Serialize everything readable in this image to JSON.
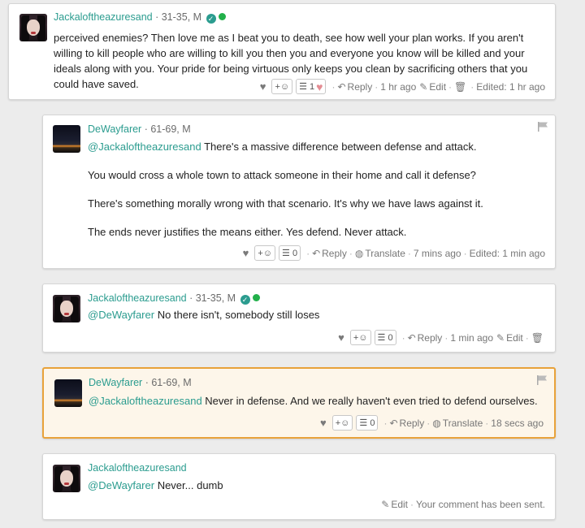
{
  "comments": [
    {
      "username": "Jackaloftheazuresand",
      "demo": "31-35, M",
      "verified": true,
      "online": true,
      "body": "perceived enemies? Then love me as I beat you to death, see how well your plan works. If you aren't willing to kill people who are willing to kill you then you and everyone you know will be killed and your ideals along with you. Your pride for being virtuous only keeps you clean by sacrificing others that you could have saved.",
      "smile": "+☺",
      "count": "1",
      "reply": "Reply",
      "time": "1 hr ago",
      "edit": "Edit",
      "edited": "Edited: 1 hr ago"
    },
    {
      "username": "DeWayfarer",
      "demo": "61-69, M",
      "mention": "@Jackaloftheazuresand",
      "body_first": "There's a massive difference between defense and attack.",
      "paragraphs": [
        "You would cross a whole town to attack someone in their home and call it defense?",
        "There's something morally wrong with that scenario. It's why we have laws against it.",
        "The ends never justifies the means either. Yes defend. Never attack."
      ],
      "smile": "+☺",
      "count": "0",
      "reply": "Reply",
      "translate": "Translate",
      "time": "7 mins ago",
      "edited": "Edited: 1 min ago"
    },
    {
      "username": "Jackaloftheazuresand",
      "demo": "31-35, M",
      "mention": "@DeWayfarer",
      "body": "No there isn't, somebody still loses",
      "smile": "+☺",
      "count": "0",
      "reply": "Reply",
      "time": "1 min ago",
      "edit": "Edit"
    },
    {
      "username": "DeWayfarer",
      "demo": "61-69, M",
      "mention": "@Jackaloftheazuresand",
      "body": "Never in defense. And we really haven't even tried to defend ourselves.",
      "smile": "+☺",
      "count": "0",
      "reply": "Reply",
      "translate": "Translate",
      "time": "18 secs ago"
    },
    {
      "username": "Jackaloftheazuresand",
      "mention": "@DeWayfarer",
      "body": "Never... dumb",
      "edit": "Edit",
      "status": "Your comment has been sent."
    }
  ],
  "colors": {
    "accent": "#2b9c8f",
    "online": "#22b04a",
    "highlight_border": "#e8a23a",
    "highlight_bg": "#fdf6ea"
  }
}
